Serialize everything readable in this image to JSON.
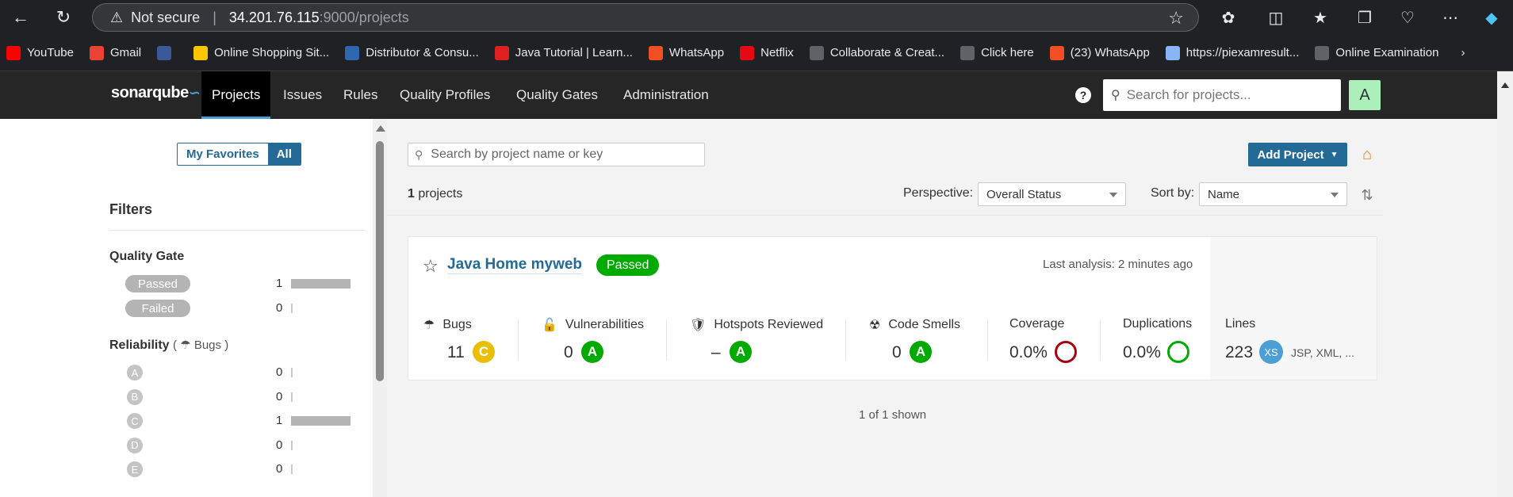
{
  "browser": {
    "not_secure": "Not secure",
    "host": "34.201.76.115",
    "path": ":9000/projects",
    "bookmarks": [
      {
        "label": "YouTube",
        "color": "#ff0000"
      },
      {
        "label": "Gmail",
        "color": "#ea4335"
      },
      {
        "label": "",
        "color": "#3b5998"
      },
      {
        "label": "Online Shopping Sit...",
        "color": "#f9c600"
      },
      {
        "label": "Distributor & Consu...",
        "color": "#2f68b1"
      },
      {
        "label": "Java Tutorial | Learn...",
        "color": "#e02020"
      },
      {
        "label": "WhatsApp",
        "color": "#f04e23"
      },
      {
        "label": "Netflix",
        "color": "#e50914"
      },
      {
        "label": "Collaborate & Creat...",
        "color": "#5f6368"
      },
      {
        "label": "Click here",
        "color": "#5f6368"
      },
      {
        "label": "(23) WhatsApp",
        "color": "#f04e23"
      },
      {
        "label": "https://piexamresult...",
        "color": "#8ab4f8"
      },
      {
        "label": "Online Examination",
        "color": "#5f6368"
      }
    ]
  },
  "nav": {
    "logo": "sonarqube",
    "items": [
      "Projects",
      "Issues",
      "Rules",
      "Quality Profiles",
      "Quality Gates",
      "Administration"
    ],
    "search_placeholder": "Search for projects...",
    "avatar": "A"
  },
  "sidebar": {
    "my_favorites": "My Favorites",
    "all": "All",
    "filters": "Filters",
    "quality_gate": {
      "title": "Quality Gate",
      "items": [
        {
          "label": "Passed",
          "count": "1",
          "fraction": 1.0
        },
        {
          "label": "Failed",
          "count": "0",
          "fraction": 0
        }
      ]
    },
    "reliability": {
      "title": "Reliability",
      "sub": "Bugs",
      "items": [
        {
          "label": "A",
          "count": "0",
          "fraction": 0
        },
        {
          "label": "B",
          "count": "0",
          "fraction": 0
        },
        {
          "label": "C",
          "count": "1",
          "fraction": 1.0
        },
        {
          "label": "D",
          "count": "0",
          "fraction": 0
        },
        {
          "label": "E",
          "count": "0",
          "fraction": 0
        }
      ]
    }
  },
  "main": {
    "search_placeholder": "Search by project name or key",
    "add_project": "Add Project",
    "count": "1",
    "count_suffix": " projects",
    "perspective_label": "Perspective:",
    "perspective_value": "Overall Status",
    "sort_label": "Sort by:",
    "sort_value": "Name",
    "shown": "1 of 1 shown"
  },
  "project": {
    "name": "Java Home myweb",
    "status": "Passed",
    "last_analysis": "Last analysis: 2 minutes ago",
    "metrics": {
      "bugs": {
        "label": "Bugs",
        "value": "11",
        "rating": "C"
      },
      "vulnerabilities": {
        "label": "Vulnerabilities",
        "value": "0",
        "rating": "A"
      },
      "hotspots": {
        "label": "Hotspots Reviewed",
        "value": "–",
        "rating": "A"
      },
      "code_smells": {
        "label": "Code Smells",
        "value": "0",
        "rating": "A"
      },
      "coverage": {
        "label": "Coverage",
        "value": "0.0%"
      },
      "duplications": {
        "label": "Duplications",
        "value": "0.0%"
      },
      "lines": {
        "label": "Lines",
        "value": "223",
        "size": "XS",
        "languages": "JSP, XML, ..."
      }
    }
  },
  "colors": {
    "rating_a": "#00aa00",
    "rating_c": "#eabe06",
    "coverage_ring": "#a4030f",
    "duplication_ring": "#00aa00",
    "accent": "#236a97"
  }
}
